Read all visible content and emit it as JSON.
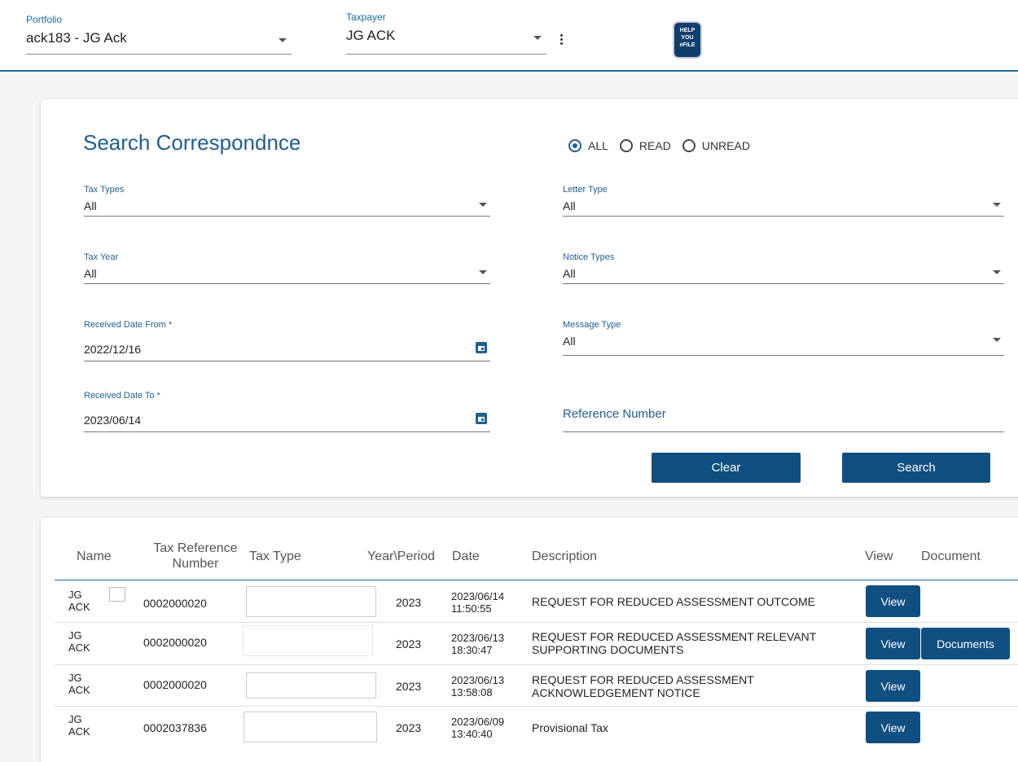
{
  "header": {
    "portfolio": {
      "label": "Portfolio",
      "value": "ack183 - JG Ack"
    },
    "taxpayer": {
      "label": "Taxpayer",
      "value": "JG ACK"
    },
    "logo_text": "HELP YOU eFILE"
  },
  "search": {
    "title": "Search Correspondnce",
    "filter": {
      "options": [
        "ALL",
        "READ",
        "UNREAD"
      ],
      "selected": "ALL"
    },
    "tax_types": {
      "label": "Tax Types",
      "value": "All"
    },
    "letter_type": {
      "label": "Letter Type",
      "value": "All"
    },
    "tax_year": {
      "label": "Tax Year",
      "value": "All"
    },
    "notice_types": {
      "label": "Notice Types",
      "value": "All"
    },
    "date_from": {
      "label": "Received Date From *",
      "value": "2022/12/16"
    },
    "message_type": {
      "label": "Message Type",
      "value": "All"
    },
    "date_to": {
      "label": "Received Date To *",
      "value": "2023/06/14"
    },
    "reference_number": {
      "label": "Reference Number",
      "value": ""
    },
    "clear_label": "Clear",
    "search_label": "Search"
  },
  "table": {
    "columns": {
      "name": "Name",
      "tax_ref": "Tax Reference Number",
      "tax_type": "Tax Type",
      "year_period": "Year\\Period",
      "date": "Date",
      "description": "Description",
      "view": "View",
      "document": "Document"
    },
    "rows": [
      {
        "name": "JG ACK",
        "tax_ref": "0002000020",
        "year": "2023",
        "date": "2023/06/14 11:50:55",
        "description": "REQUEST FOR REDUCED ASSESSMENT OUTCOME",
        "view_label": "View",
        "documents_label": ""
      },
      {
        "name": "JG ACK",
        "tax_ref": "0002000020",
        "year": "2023",
        "date": "2023/06/13 18:30:47",
        "description": "REQUEST FOR REDUCED ASSESSMENT RELEVANT SUPPORTING DOCUMENTS",
        "view_label": "View",
        "documents_label": "Documents"
      },
      {
        "name": "JG ACK",
        "tax_ref": "0002000020",
        "year": "2023",
        "date": "2023/06/13 13:58:08",
        "description": "REQUEST FOR REDUCED ASSESSMENT ACKNOWLEDGEMENT NOTICE",
        "view_label": "View",
        "documents_label": ""
      },
      {
        "name": "JG ACK",
        "tax_ref": "0002037836",
        "year": "2023",
        "date": "2023/06/09 13:40:40",
        "description": "Provisional Tax",
        "view_label": "View",
        "documents_label": ""
      }
    ]
  }
}
